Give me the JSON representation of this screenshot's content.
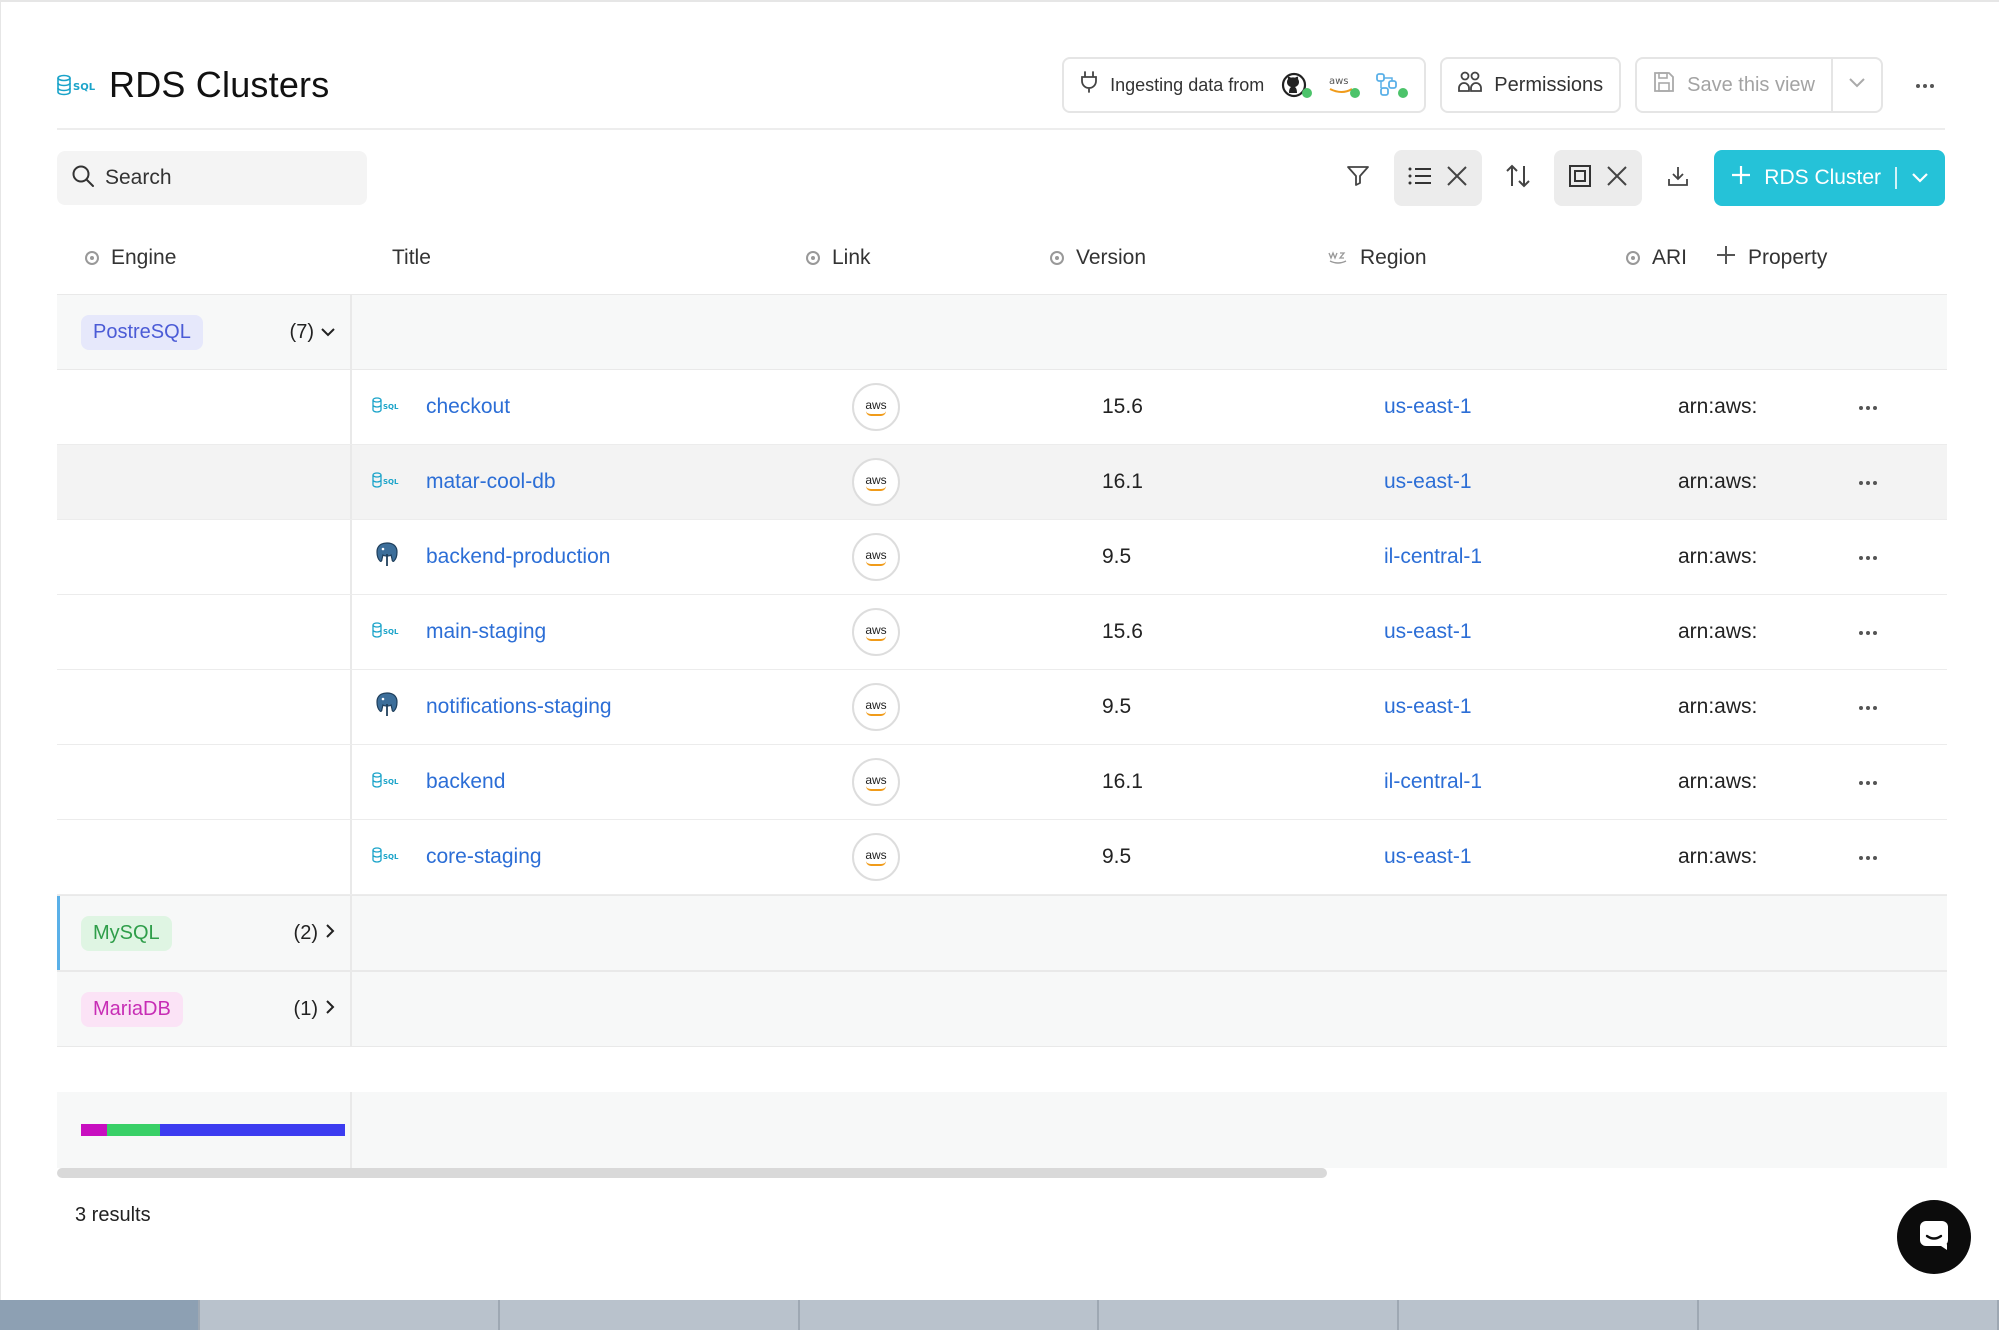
{
  "header": {
    "title": "RDS Clusters",
    "ingesting_label": "Ingesting data from",
    "aws_label": "aws",
    "permissions_label": "Permissions",
    "save_view_label": "Save this view"
  },
  "toolbar": {
    "search_placeholder": "Search",
    "add_button_label": "RDS Cluster"
  },
  "columns": {
    "engine": "Engine",
    "title": "Title",
    "link": "Link",
    "version": "Version",
    "region": "Region",
    "ari": "ARI",
    "add_property": "Property"
  },
  "groups": [
    {
      "name": "PostreSQL",
      "count": "(7)",
      "expanded": true,
      "color": "#4b5bd6",
      "bg": "#e6e8fb"
    },
    {
      "name": "MySQL",
      "count": "(2)",
      "expanded": false,
      "color": "#2f9e4a",
      "bg": "#dff5e3"
    },
    {
      "name": "MariaDB",
      "count": "(1)",
      "expanded": false,
      "color": "#c72db5",
      "bg": "#fbe3f6"
    }
  ],
  "rows": [
    {
      "icon": "sql-database-icon",
      "title": "checkout",
      "link": "aws",
      "version": "15.6",
      "region": "us-east-1",
      "ari": "arn:aws:"
    },
    {
      "icon": "sql-database-icon",
      "title": "matar-cool-db",
      "link": "aws",
      "version": "16.1",
      "region": "us-east-1",
      "ari": "arn:aws:"
    },
    {
      "icon": "postgres-elephant-icon",
      "title": "backend-production",
      "link": "aws",
      "version": "9.5",
      "region": "il-central-1",
      "ari": "arn:aws:"
    },
    {
      "icon": "sql-database-icon",
      "title": "main-staging",
      "link": "aws",
      "version": "15.6",
      "region": "us-east-1",
      "ari": "arn:aws:"
    },
    {
      "icon": "postgres-elephant-icon",
      "title": "notifications-staging",
      "link": "aws",
      "version": "9.5",
      "region": "us-east-1",
      "ari": "arn:aws:"
    },
    {
      "icon": "sql-database-icon",
      "title": "backend",
      "link": "aws",
      "version": "16.1",
      "region": "il-central-1",
      "ari": "arn:aws:"
    },
    {
      "icon": "sql-database-icon",
      "title": "core-staging",
      "link": "aws",
      "version": "9.5",
      "region": "us-east-1",
      "ari": "arn:aws:"
    }
  ],
  "distribution": [
    {
      "label": "MariaDB",
      "fraction": 0.1,
      "color": "#c80fc0"
    },
    {
      "label": "MySQL",
      "fraction": 0.2,
      "color": "#39d067"
    },
    {
      "label": "PostreSQL",
      "fraction": 0.7,
      "color": "#3c3cf0"
    }
  ],
  "footer": {
    "results": "3 results"
  },
  "colors": {
    "accent": "#25c2d8",
    "link": "#2c6ed6"
  }
}
